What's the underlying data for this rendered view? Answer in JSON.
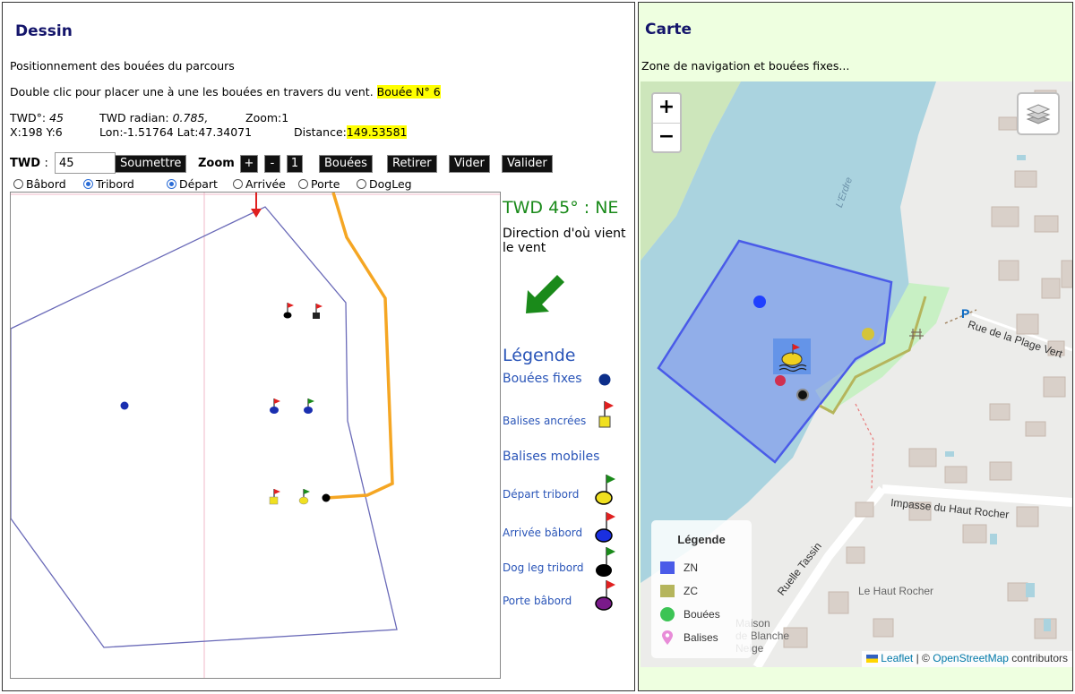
{
  "left": {
    "title": "Dessin",
    "subtitle": "Positionnement des bouées du parcours",
    "instruction": "Double clic pour placer une à une les bouées en travers du vent.",
    "buoy_badge": "Bouée N° 6",
    "info": {
      "twd_label": "TWD°:",
      "twd_value": "45",
      "twd_rad_label": "TWD radian:",
      "twd_rad_value": "0.785,",
      "zoom_text": "Zoom:1",
      "xy_text": "X:198 Y:6",
      "lonlat_text": "Lon:-1.51764 Lat:47.34071",
      "distance_label": "Distance:",
      "distance_value": "149.53581"
    },
    "toolbar": {
      "twd_label": "TWD",
      "twd_colon": ":",
      "twd_input_value": "45",
      "submit_label": "Soumettre",
      "zoom_label": "Zoom",
      "zoom_in": "+",
      "zoom_out": "-",
      "zoom_reset": "1",
      "buoys_label": "Bouées",
      "remove_label": "Retirer",
      "clear_label": "Vider",
      "validate_label": "Valider"
    },
    "radios": [
      {
        "label": "Bâbord",
        "checked": false
      },
      {
        "label": "Tribord",
        "checked": true
      },
      {
        "label": "Départ",
        "checked": true
      },
      {
        "label": "Arrivée",
        "checked": false
      },
      {
        "label": "Porte",
        "checked": false
      },
      {
        "label": "DogLeg",
        "checked": false
      }
    ],
    "side": {
      "twd_title": "TWD 45° : NE",
      "twd_desc": "Direction d'où vient le vent",
      "legend_title": "Légende",
      "legend": {
        "fixed": "Bouées fixes",
        "anchored": "Balises ancrées",
        "mobile": "Balises mobiles",
        "start": "Départ tribord",
        "finish": "Arrivée bâbord",
        "dogleg": "Dog leg tribord",
        "gate": "Porte bâbord"
      }
    },
    "colors": {
      "title": "#14156b",
      "legend_blue": "#2a55b8",
      "wind_green": "#1a8a1a",
      "zone_stroke": "#6a6ab8",
      "orange_line": "#f5a623"
    }
  },
  "right": {
    "title": "Carte",
    "subtitle": "Zone de navigation et bouées fixes...",
    "zoom_in": "+",
    "zoom_out": "−",
    "map_labels": {
      "river": "L'Erdre",
      "street1": "Rue de la Plage Vert",
      "street2": "Impasse du Haut Rocher",
      "street3": "Ruelle Tassin",
      "place1": "Le Haut Rocher",
      "place2a": "Maison",
      "place2b": "de Blanche",
      "place2c": "Neige",
      "parking": "P"
    },
    "legend": {
      "title": "Légende",
      "zn": "ZN",
      "zc": "ZC",
      "bouees": "Bouées",
      "balises": "Balises"
    },
    "attribution": {
      "leaflet": "Leaflet",
      "sep": "| ©",
      "osm": "OpenStreetMap",
      "contrib": "contributors"
    },
    "colors": {
      "water": "#aad3df",
      "zn_fill": "#7c8ff0",
      "zn_stroke": "#4a5be8",
      "zc": "#b5b55c",
      "bouees": "#3cc455",
      "balises": "#e88cd8",
      "park": "#c8f0c4"
    }
  }
}
